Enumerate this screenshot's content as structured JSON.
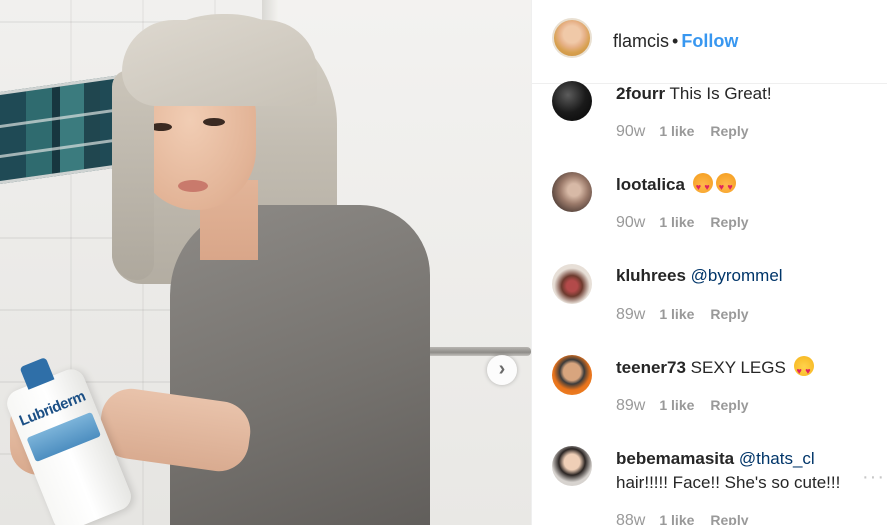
{
  "post": {
    "owner": "flamcis",
    "separator": "•",
    "follow_label": "Follow",
    "carousel_next_glyph": "›",
    "bottle_brand": "Lubriderm"
  },
  "comments": [
    {
      "user": "2fourr",
      "text": "This Is Great!",
      "mention": "",
      "text2": "",
      "emoji": "",
      "time": "90w",
      "likes": "1 like",
      "reply": "Reply"
    },
    {
      "user": "lootalica",
      "text": "",
      "mention": "",
      "text2": "",
      "emoji": "heart-eyes-cat x2",
      "time": "90w",
      "likes": "1 like",
      "reply": "Reply"
    },
    {
      "user": "kluhrees",
      "text": "",
      "mention": "@byrommel",
      "text2": "",
      "emoji": "",
      "time": "89w",
      "likes": "1 like",
      "reply": "Reply"
    },
    {
      "user": "teener73",
      "text": "SEXY LEGS",
      "mention": "",
      "text2": "",
      "emoji": "heart-eyes",
      "time": "89w",
      "likes": "1 like",
      "reply": "Reply"
    },
    {
      "user": "bebemamasita",
      "text": "",
      "mention": "@thats_cl",
      "text2": "hair!!!!! Face!! She's so cute!!!",
      "emoji": "",
      "time": "88w",
      "likes": "1 like",
      "reply": "Reply"
    }
  ],
  "colors": {
    "accent": "#3897f0",
    "mention": "#003569",
    "meta": "#999999",
    "text": "#262626"
  },
  "icons": {
    "more": "more-options-icon",
    "next": "chevron-right-icon"
  }
}
